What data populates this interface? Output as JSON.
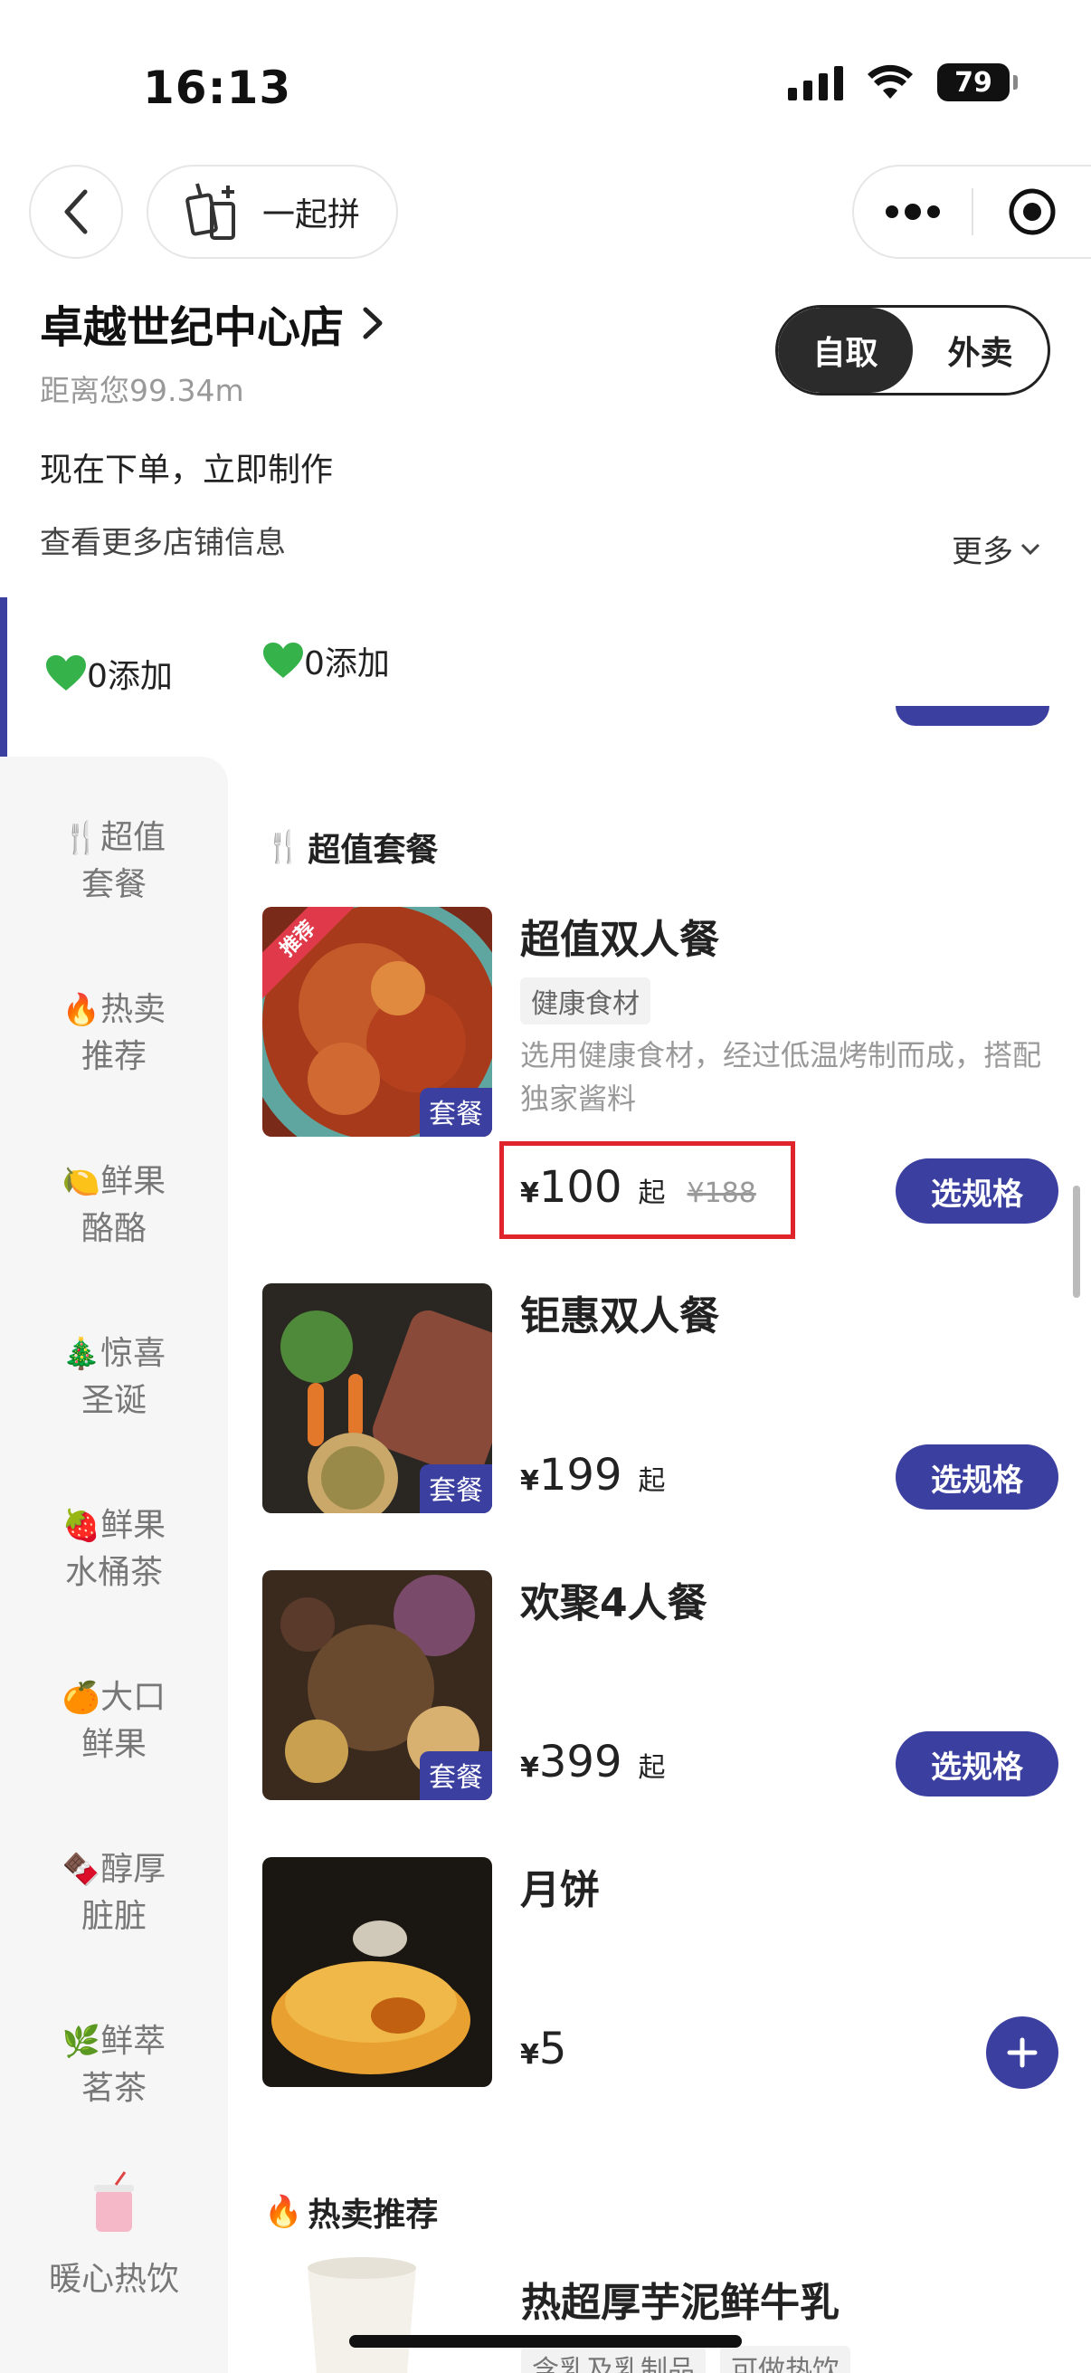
{
  "status_bar": {
    "time": "16:13",
    "battery": "79"
  },
  "nav": {
    "group_order_label": "一起拼"
  },
  "store": {
    "name": "卓越世纪中心店",
    "distance": "距离您99.34m",
    "order_now": "现在下单，立即制作",
    "more_info": "查看更多店铺信息",
    "more_toggle": "更多"
  },
  "mode_switch": {
    "pickup": "自取",
    "delivery": "外卖"
  },
  "favorites": [
    {
      "label": "0添加"
    },
    {
      "label": "0添加"
    }
  ],
  "sidebar": {
    "items": [
      {
        "emoji": "🍴",
        "line1": "超值",
        "line2": "套餐"
      },
      {
        "emoji": "🔥",
        "line1": "热卖",
        "line2": "推荐"
      },
      {
        "emoji": "🍋",
        "line1": "鲜果",
        "line2": "酪酪"
      },
      {
        "emoji": "🎄",
        "line1": "惊喜",
        "line2": "圣诞"
      },
      {
        "emoji": "🍓",
        "line1": "鲜果",
        "line2": "水桶茶"
      },
      {
        "emoji": "🍊",
        "line1": "大口",
        "line2": "鲜果"
      },
      {
        "emoji": "🍫",
        "line1": "醇厚",
        "line2": "脏脏"
      },
      {
        "emoji": "🌿",
        "line1": "鲜萃",
        "line2": "茗茶"
      },
      {
        "label": "暖心热饮"
      }
    ]
  },
  "sections": {
    "combo": "超值套餐",
    "hot": "热卖推荐"
  },
  "products": [
    {
      "name": "超值双人餐",
      "tag": "健康食材",
      "desc": "选用健康食材，经过低温烤制而成，搭配独家酱料",
      "currency": "¥",
      "price": "100",
      "suffix": "起",
      "original": "¥188",
      "badge": "套餐",
      "ribbon": "推荐",
      "action": "选规格"
    },
    {
      "name": "钜惠双人餐",
      "currency": "¥",
      "price": "199",
      "suffix": "起",
      "badge": "套餐",
      "action": "选规格"
    },
    {
      "name": "欢聚4人餐",
      "currency": "¥",
      "price": "399",
      "suffix": "起",
      "badge": "套餐",
      "action": "选规格"
    },
    {
      "name": "月饼",
      "currency": "¥",
      "price": "5"
    }
  ],
  "next_product": {
    "name": "热超厚芋泥鲜牛乳",
    "tags": [
      "含乳及乳制品",
      "可做热饮"
    ]
  },
  "colors": {
    "accent": "#3b3fa0",
    "highlight": "#e0242c"
  }
}
